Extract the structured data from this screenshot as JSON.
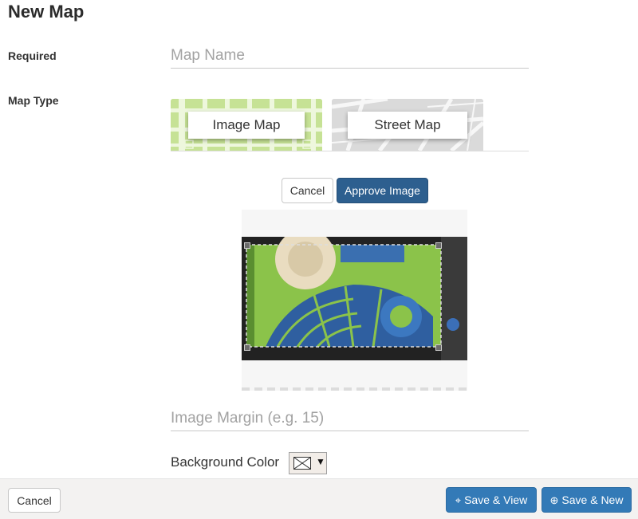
{
  "page": {
    "title": "New Map"
  },
  "fields": {
    "required_label": "Required",
    "map_name_placeholder": "Map Name",
    "map_type_label": "Map Type",
    "image_margin_placeholder": "Image Margin (e.g. 15)",
    "background_color_label": "Background Color"
  },
  "map_types": {
    "image_label": "Image Map",
    "street_label": "Street Map"
  },
  "crop": {
    "cancel_label": "Cancel",
    "approve_label": "Approve Image"
  },
  "footer": {
    "cancel_label": "Cancel",
    "save_view_label": "Save & View",
    "save_new_label": "Save & New"
  },
  "icons": {
    "save_view": "crosshair-icon",
    "save_new": "plus-circle-icon",
    "color_picker_caret": "caret-down-icon"
  },
  "colors": {
    "primary": "#337ab7",
    "approve": "#2d5f8f",
    "footer_bg": "#f3f2f1"
  }
}
